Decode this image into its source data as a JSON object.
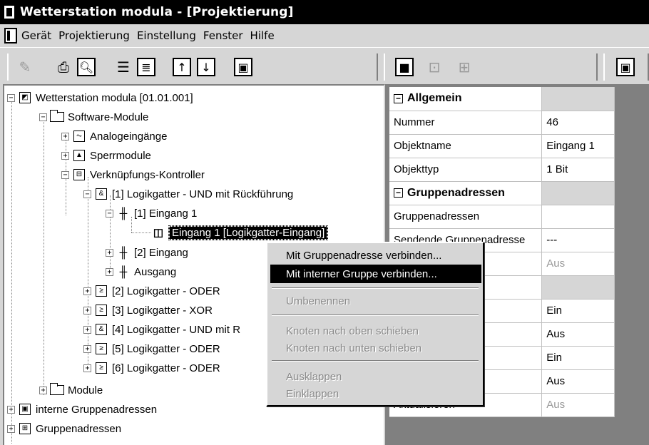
{
  "window": {
    "title": "Wetterstation modula  - [Projektierung]"
  },
  "menubar": {
    "items": [
      "Gerät",
      "Projektierung",
      "Einstellung",
      "Fenster",
      "Hilfe"
    ]
  },
  "toolbar": {
    "icons": [
      "pencil-icon",
      "printer-icon",
      "print-preview-icon",
      "list-icon",
      "tree-list-icon",
      "arrow-up-icon",
      "arrow-down-icon",
      "monitor-icon",
      "lock-icon",
      "gate-icon",
      "gate-input-icon",
      "frame-icon"
    ]
  },
  "tree": {
    "root": {
      "label": "Wetterstation modula [01.01.001]"
    },
    "software_modules": {
      "label": "Software-Module"
    },
    "analog_inputs": {
      "label": "Analogeingänge"
    },
    "lock_modules": {
      "label": "Sperrmodule"
    },
    "logic_controller": {
      "label": "Verknüpfungs-Kontroller"
    },
    "gate1": {
      "label": "[1] Logikgatter - UND mit Rückführung"
    },
    "gate1_input1": {
      "label": "[1] Eingang 1"
    },
    "gate1_input1_child": {
      "label": "Eingang 1 [Logikgatter-Eingang]"
    },
    "gate1_input2": {
      "label": "[2] Eingang"
    },
    "gate1_output": {
      "label": "Ausgang"
    },
    "gate2": {
      "label": "[2] Logikgatter - ODER"
    },
    "gate3": {
      "label": "[3] Logikgatter - XOR"
    },
    "gate4": {
      "label": "[4] Logikgatter - UND mit R"
    },
    "gate5": {
      "label": "[5] Logikgatter - ODER"
    },
    "gate6": {
      "label": "[6] Logikgatter - ODER"
    },
    "modules": {
      "label": "Module"
    },
    "internal_groups": {
      "label": "interne Gruppenadressen"
    },
    "group_addresses": {
      "label": "Gruppenadressen"
    }
  },
  "properties": {
    "sec_general": {
      "toggle": "−",
      "label": "Allgemein",
      "value": ""
    },
    "number": {
      "label": "Nummer",
      "value": "46"
    },
    "object_name": {
      "label": "Objektname",
      "value": "Eingang 1"
    },
    "object_type": {
      "label": "Objekttyp",
      "value": "1 Bit"
    },
    "sec_groups": {
      "toggle": "−",
      "label": "Gruppenadressen",
      "value": ""
    },
    "group_addresses": {
      "label": "Gruppenadressen",
      "value": ""
    },
    "sending_group": {
      "label": "Sendende Gruppenadresse",
      "value": "---"
    },
    "row8": {
      "label": "",
      "value": "Aus"
    },
    "row9": {
      "label": "",
      "value": ""
    },
    "row10": {
      "label": "",
      "value": "Ein"
    },
    "row11": {
      "label": "",
      "value": "Aus"
    },
    "row12": {
      "label": "",
      "value": "Ein"
    },
    "row13": {
      "label": "",
      "value": "Aus"
    },
    "update": {
      "label": "Aktualisieren",
      "value": "Aus"
    }
  },
  "context_menu": {
    "connect_group": "Mit Gruppenadresse verbinden...",
    "connect_internal": "Mit interner Gruppe verbinden...",
    "rename": "Umbenennen",
    "move_up": "Knoten nach oben schieben",
    "move_down": "Knoten nach unten schieben",
    "expand": "Ausklappen",
    "collapse": "Einklappen"
  }
}
